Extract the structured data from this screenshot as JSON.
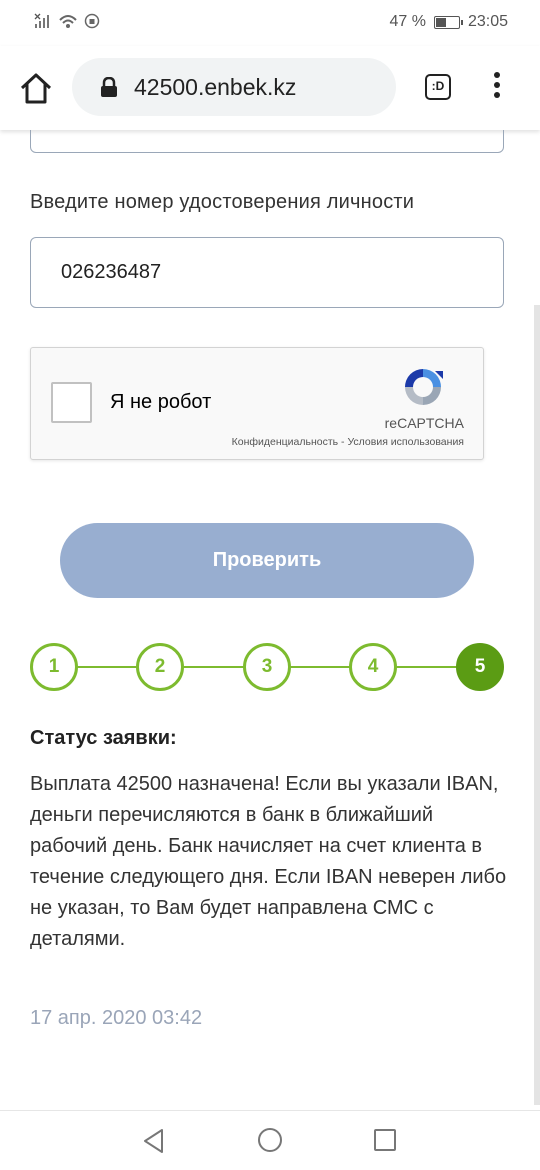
{
  "status_bar": {
    "battery": "47 %",
    "battery_level": 0.47,
    "time": "23:05",
    "icons": [
      "signal-off-icon",
      "wifi-icon",
      "data-saver-icon",
      "battery-icon"
    ]
  },
  "browser": {
    "url": "42500.enbek.kz",
    "tabs_label": ":D"
  },
  "form": {
    "id_label": "Введите номер удостоверения личности",
    "id_value": "026236487",
    "captcha_label": "Я не робот",
    "captcha_brand": "reCAPTCHA",
    "captcha_links": "Конфиденциальность - Условия использования",
    "submit_label": "Проверить"
  },
  "steps": {
    "items": [
      "1",
      "2",
      "3",
      "4",
      "5"
    ],
    "active": "5",
    "color": "#7dbb2f",
    "active_color": "#5b9c14"
  },
  "status": {
    "title": "Статус заявки:",
    "body": "Выплата 42500 назначена! Если вы указали IBAN, деньги перечисляются в банк в ближайший рабочий день. Банк начисляет на счет клиента в течение следующего дня. Если IBAN неверен либо не указан, то Вам будет направлена СМС с деталями.",
    "date": "17 апр. 2020 03:42"
  },
  "colors": {
    "button": "#98aed0",
    "date": "#9aa5b8"
  }
}
